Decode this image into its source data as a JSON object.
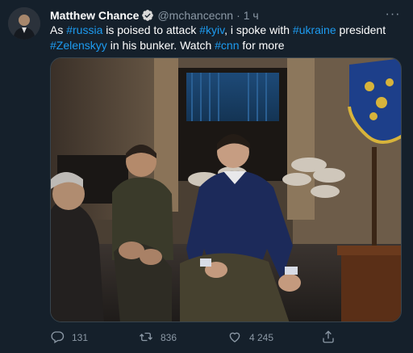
{
  "tweet": {
    "author_name": "Matthew Chance",
    "handle": "@mchancecnn",
    "separator": "·",
    "time": "1 ч",
    "more_label": "···",
    "text_parts": {
      "p1": "As ",
      "tag_russia": "#russia",
      "p2": " is poised to attack ",
      "tag_kyiv": "#kyiv",
      "p3": ", i spoke with ",
      "tag_ukraine": "#ukraine",
      "p4": " president ",
      "tag_zelenskyy": "#Zelenskyy",
      "p5": " in his bunker. Watch ",
      "tag_cnn": "#cnn",
      "p6": " for more"
    },
    "counts": {
      "replies": "131",
      "retweets": "836",
      "likes": "4 245"
    }
  },
  "icons": {
    "verified": "verified-badge-icon",
    "reply": "reply-icon",
    "retweet": "retweet-icon",
    "like": "heart-icon",
    "share": "share-icon",
    "more": "more-icon"
  },
  "colors": {
    "background": "#15202b",
    "link": "#1d9bf0",
    "muted": "#8b98a5",
    "border": "#38444d"
  }
}
